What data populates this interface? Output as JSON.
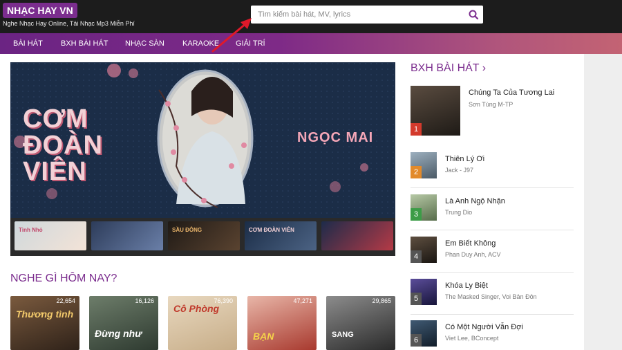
{
  "header": {
    "logo": "NHẠC HAY VN",
    "tagline": "Nghe Nhạc Hay Online, Tải Nhạc Mp3 Miễn Phí",
    "search_placeholder": "Tìm kiếm bài hát, MV, lyrics"
  },
  "nav": {
    "items": [
      "BÀI HÁT",
      "BXH BÀI HÁT",
      "NHẠC SÀN",
      "KARAOKE",
      "GIẢI TRÍ"
    ]
  },
  "banner": {
    "title_lines": [
      "CƠM",
      "ĐOÀN",
      "VIÊN"
    ],
    "artist": "NGỌC MAI"
  },
  "thumbs": [
    {
      "label": "Tình Nhỏ"
    },
    {
      "label": ""
    },
    {
      "label": "SẦU ĐÔNG"
    },
    {
      "label": "CƠM ĐOÀN VIÊN"
    },
    {
      "label": ""
    },
    {
      "label": ""
    }
  ],
  "today": {
    "title": "NGHE GÌ HÔM NAY?",
    "cards": [
      {
        "count": "22,654",
        "text": "Thương tình",
        "color": "#5a3a2a"
      },
      {
        "count": "16,126",
        "text": "Đừng như",
        "color": "#4a5a4a"
      },
      {
        "count": "76,390",
        "text": "Cô Phòng",
        "color": "#d9c2a4"
      },
      {
        "count": "47,271",
        "text": "BẠN",
        "color": "#b0473a"
      },
      {
        "count": "29,865",
        "text": "SANG",
        "color": "#3a3a3a"
      }
    ]
  },
  "bxh": {
    "title": "BXH BÀI HÁT",
    "songs": [
      {
        "rank": "1",
        "name": "Chúng Ta Của Tương Lai",
        "artist": "Sơn Tùng M-TP",
        "color": "#3b332d",
        "rank_color": "#d33a2c"
      },
      {
        "rank": "2",
        "name": "Thiên Lý Ơi",
        "artist": "Jack - J97",
        "color": "#6a7d8c",
        "rank_color": "#e28a2b"
      },
      {
        "rank": "3",
        "name": "Là Anh Ngộ Nhận",
        "artist": "Trung Dio",
        "color": "#8aa07a",
        "rank_color": "#3c9c47"
      },
      {
        "rank": "4",
        "name": "Em Biết Không",
        "artist": "Phan Duy Anh, ACV",
        "color": "#2f2a25",
        "rank_color": "#555555"
      },
      {
        "rank": "5",
        "name": "Khóa Ly Biệt",
        "artist": "The Masked Singer, Voi Bản Đôn",
        "color": "#2d2a5a",
        "rank_color": "#555555"
      },
      {
        "rank": "6",
        "name": "Có Một Người Vẫn Đợi",
        "artist": "Viet Lee, BConcept",
        "color": "#22313f",
        "rank_color": "#555555"
      }
    ]
  }
}
